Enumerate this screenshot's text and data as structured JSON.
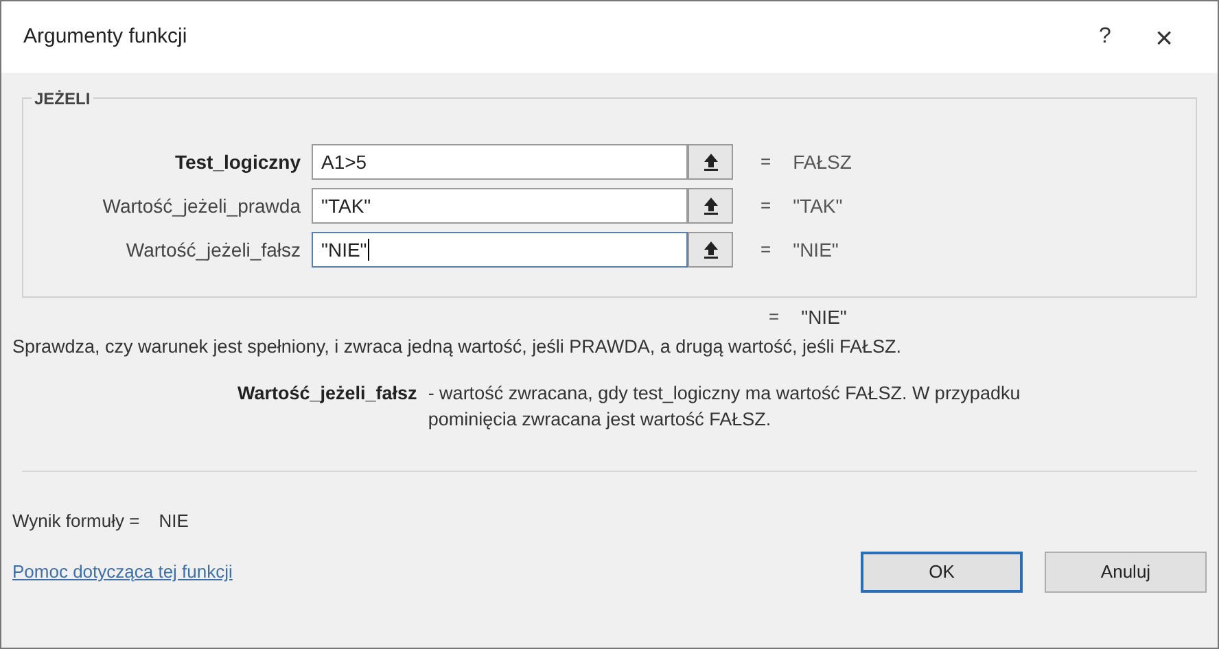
{
  "window": {
    "title": "Argumenty funkcji",
    "help_button": "?",
    "close_button": "×"
  },
  "group": {
    "title": "JEŻELI",
    "arguments": [
      {
        "label": "Test_logiczny",
        "value": "A1>5",
        "result": "FAŁSZ",
        "focused": false,
        "bold": true
      },
      {
        "label": "Wartość_jeżeli_prawda",
        "value": "\"TAK\"",
        "result": "\"TAK\"",
        "focused": false,
        "bold": false
      },
      {
        "label": "Wartość_jeżeli_fałsz",
        "value": "\"NIE\"",
        "result": "\"NIE\"",
        "focused": true,
        "bold": false
      }
    ]
  },
  "equals": "=",
  "function_result": "\"NIE\"",
  "description": "Sprawdza, czy warunek jest spełniony, i zwraca jedną wartość, jeśli PRAWDA, a drugą wartość, jeśli FAŁSZ.",
  "argument_help": {
    "name": "Wartość_jeżeli_fałsz",
    "text": "- wartość zwracana, gdy test_logiczny ma wartość FAŁSZ. W przypadku pominięcia zwracana jest wartość FAŁSZ."
  },
  "formula_result": {
    "label": "Wynik formuły =",
    "value": "NIE"
  },
  "help_link": "Pomoc dotycząca tej funkcji",
  "buttons": [
    {
      "label": "OK",
      "default": true
    },
    {
      "label": "Anuluj",
      "default": false
    }
  ]
}
